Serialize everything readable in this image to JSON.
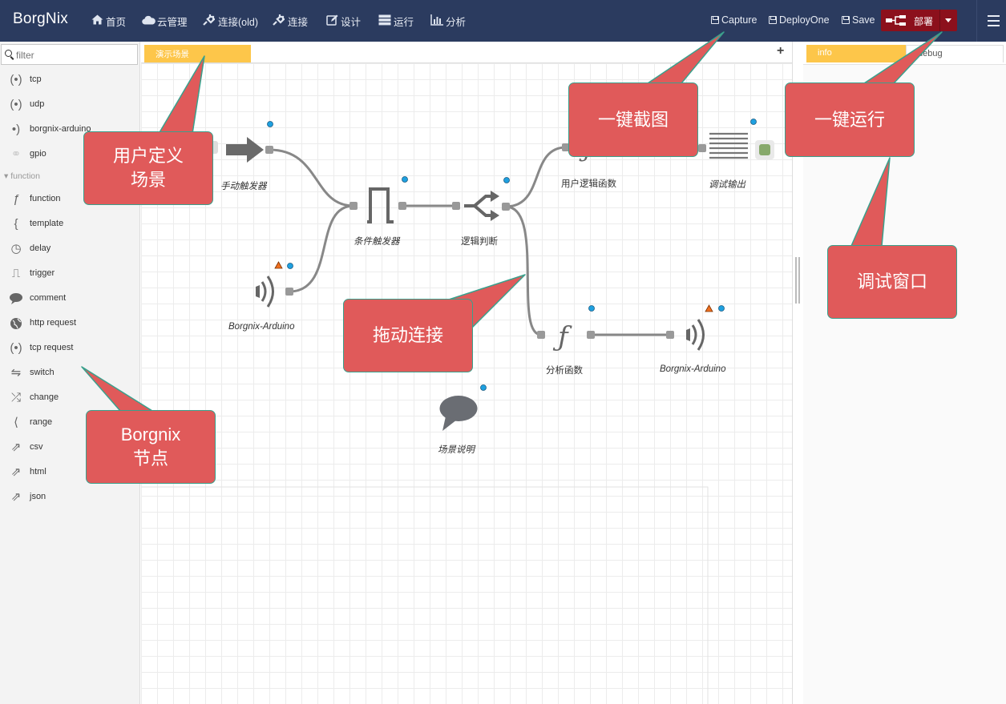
{
  "header": {
    "brand": "BorgNix",
    "nav": [
      {
        "label": "首页",
        "icon": "home-icon"
      },
      {
        "label": "云管理",
        "icon": "cloud-icon"
      },
      {
        "label": "连接(old)",
        "icon": "plug-icon"
      },
      {
        "label": "连接",
        "icon": "plug-icon"
      },
      {
        "label": "设计",
        "icon": "edit-icon"
      },
      {
        "label": "运行",
        "icon": "server-icon"
      },
      {
        "label": "分析",
        "icon": "bar-chart-icon"
      }
    ],
    "capture_label": "Capture",
    "deploy_one_label": "DeployOne",
    "save_label": "Save",
    "deploy_label": "部署"
  },
  "palette": {
    "filter_placeholder": "filter",
    "category": "function",
    "items_top": [
      {
        "label": "tcp",
        "icon": "broadcast-icon"
      },
      {
        "label": "udp",
        "icon": "broadcast-icon"
      },
      {
        "label": "borgnix-arduino",
        "icon": "wifi-right-icon"
      },
      {
        "label": "gpio",
        "icon": "gpio-icon"
      }
    ],
    "items_function": [
      {
        "label": "function",
        "icon": "function-icon"
      },
      {
        "label": "template",
        "icon": "brace-icon"
      },
      {
        "label": "delay",
        "icon": "clock-icon"
      },
      {
        "label": "trigger",
        "icon": "pulse-icon"
      },
      {
        "label": "comment",
        "icon": "comment-icon"
      },
      {
        "label": "http request",
        "icon": "globe-icon"
      },
      {
        "label": "tcp request",
        "icon": "broadcast-icon"
      },
      {
        "label": "switch",
        "icon": "switch-icon"
      },
      {
        "label": "change",
        "icon": "shuffle-icon"
      },
      {
        "label": "range",
        "icon": "range-icon"
      },
      {
        "label": "csv",
        "icon": "export-icon"
      },
      {
        "label": "html",
        "icon": "export-icon"
      },
      {
        "label": "json",
        "icon": "export-icon"
      }
    ]
  },
  "workspace": {
    "tab_label": "演示场景",
    "nodes": {
      "manual_trigger": "手动触发器",
      "arduino_in": "Borgnix-Arduino",
      "condition_trigger": "条件触发器",
      "logic_switch": "逻辑判断",
      "user_logic_func": "用户逻辑函数",
      "debug_output": "调试输出",
      "analysis_func": "分析函数",
      "arduino_out": "Borgnix-Arduino",
      "scene_comment": "场景说明"
    }
  },
  "sidebar": {
    "tab_info": "info",
    "tab_debug": "debug"
  },
  "callouts": {
    "user_scene": "用户定义\n场景",
    "capture": "一键截图",
    "deploy": "一键运行",
    "debug_window": "调试窗口",
    "drag_connect": "拖动连接",
    "borgnix_nodes": "Borgnix\n节点"
  },
  "colors": {
    "header_bg": "#2b3b5f",
    "deploy_bg": "#8c101c",
    "tab_accent": "#fdc64a",
    "callout_fill": "#e05a5a",
    "callout_border": "#3aa08c",
    "node_status_blue": "#1ea0e0",
    "node_status_orange": "#f07020"
  }
}
